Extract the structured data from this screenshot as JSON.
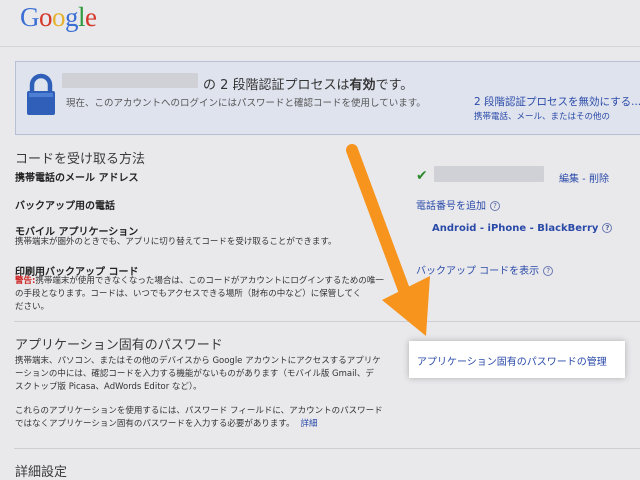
{
  "header": {
    "logo_letters": [
      {
        "ch": "G",
        "color": "#3b6fd4"
      },
      {
        "ch": "o",
        "color": "#d5372b"
      },
      {
        "ch": "o",
        "color": "#e6b12c"
      },
      {
        "ch": "g",
        "color": "#3b6fd4"
      },
      {
        "ch": "l",
        "color": "#2f9a3f"
      },
      {
        "ch": "e",
        "color": "#d5372b"
      }
    ]
  },
  "banner": {
    "title_prefix": "の 2 段階認証プロセスは",
    "title_status": "有効",
    "title_suffix": "です。",
    "description": "現在、このアカウントへのログインにはパスワードと確認コードを使用しています。",
    "disable_link": "2 段階認証プロセスを無効にする...",
    "sub_text": "携帯電話、メール、またはその他の"
  },
  "code_section": {
    "heading": "コードを受け取る方法",
    "mobile_email_label": "携帯電話のメール アドレス",
    "edit_link": "編集",
    "separator": " - ",
    "delete_link": "削除",
    "backup_phone_label": "バックアップ用の電話",
    "add_phone_link": "電話番号を追加",
    "mobile_app_label": "モバイル アプリケーション",
    "mobile_app_desc": "携帯端末が圏外のときでも、アプリに切り替えてコードを受け取ることができます。",
    "app_links": "Android - iPhone - BlackBerry",
    "print_label": "印刷用バックアップ コード",
    "print_warning": "警告:",
    "print_desc_1": "携帯端末が使用できなくなった場合は、このコードがアカウントにログインするための唯一",
    "print_desc_2": "の手段となります。コードは、いつでもアクセスできる場所（財布の中など）に保管してく",
    "print_desc_3": "ださい。",
    "show_codes_link": "バックアップ コードを表示"
  },
  "app_password_section": {
    "heading": "アプリケーション固有のパスワード",
    "desc_1": "携帯端末、パソコン、またはその他のデバイスから Google アカウントにアクセスするアプリケ",
    "desc_2": "ーションの中には、確認コードを入力する機能がないものがあります（モバイル版 Gmail、デ",
    "desc_3": "スクトップ版 Picasa、AdWords Editor など）。",
    "desc_4": "これらのアプリケーションを使用するには、パスワード フィールドに、アカウントのパスワード",
    "desc_5": "ではなくアプリケーション固有のパスワードを入力する必要があります。",
    "more_link": "詳細",
    "manage_link": "アプリケーション固有のパスワードの管理"
  },
  "advanced_section": {
    "heading": "詳細設定"
  },
  "colors": {
    "link": "#2a4aa8",
    "arrow": "#f7941d",
    "warning": "#cc2222",
    "check": "#2d8a2d"
  }
}
